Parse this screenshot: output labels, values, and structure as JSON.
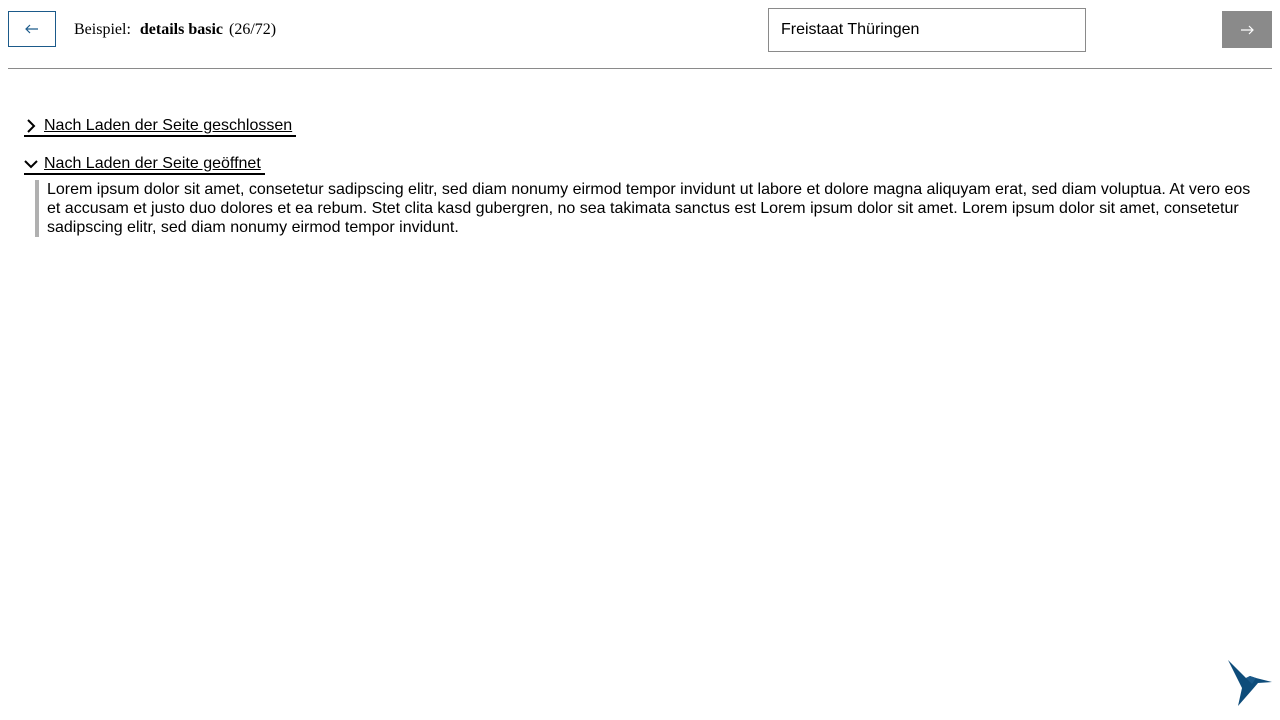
{
  "header": {
    "back_icon": "arrow-left-icon",
    "crumb_label": "Beispiel:",
    "example_name": "details basic",
    "example_count": "(26/72)",
    "search_value": "Freistaat Thüringen",
    "next_icon": "arrow-right-icon"
  },
  "details": [
    {
      "summary": "Nach Laden der Seite geschlossen",
      "state": "closed",
      "icon": "chevron-right-icon"
    },
    {
      "summary": "Nach Laden der Seite geöffnet",
      "state": "open",
      "icon": "chevron-down-icon",
      "content": "Lorem ipsum dolor sit amet, consetetur sadipscing elitr, sed diam nonumy eirmod tempor invidunt ut labore et dolore magna aliquyam erat, sed diam voluptua. At vero eos et accusam et justo duo dolores et ea rebum. Stet clita kasd gubergren, no sea takimata sanctus est Lorem ipsum dolor sit amet. Lorem ipsum dolor sit amet, con­setetur sadipscing elitr, sed diam nonumy eirmod tempor invidunt."
    }
  ],
  "footer": {
    "logo_icon": "hummingbird-logo-icon"
  },
  "colors": {
    "accent": "#1b5a8a",
    "next_button_bg": "#8a8a8a",
    "panel_border": "#b0b0b0",
    "logo": "#0e4c7a"
  }
}
